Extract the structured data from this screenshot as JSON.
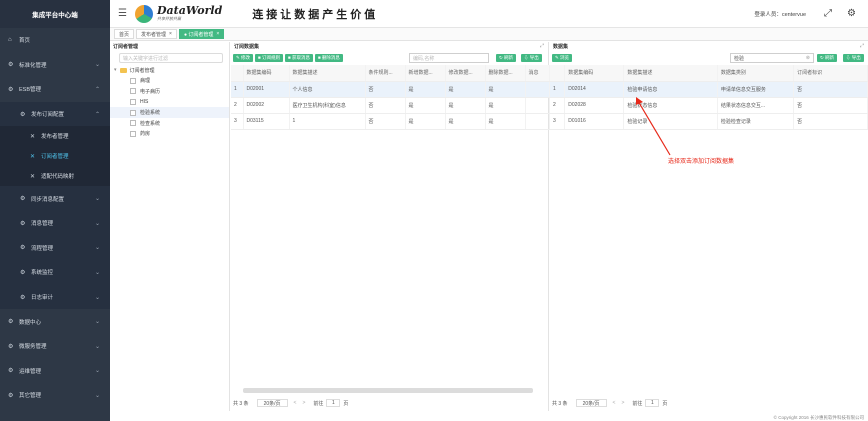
{
  "app_title": "集成平台中心端",
  "sidebar": {
    "items": [
      {
        "label": "首页",
        "icon": "home-icon",
        "glyph": "⌂"
      },
      {
        "label": "标准化管理",
        "icon": "gear-icon",
        "glyph": "⚙"
      },
      {
        "label": "ESB管理",
        "icon": "gear-icon",
        "glyph": "⚙"
      },
      {
        "label": "发布订阅配置",
        "icon": "gear-icon",
        "glyph": "⚙"
      },
      {
        "label": "发布者管理",
        "icon": "tools-icon",
        "glyph": "✕"
      },
      {
        "label": "订阅者管理",
        "icon": "tools-icon",
        "glyph": "✕"
      },
      {
        "label": "适配代码映射",
        "icon": "tools-icon",
        "glyph": "✕"
      },
      {
        "label": "同步消息配置",
        "icon": "gear-icon",
        "glyph": "⚙"
      },
      {
        "label": "消息管理",
        "icon": "gear-icon",
        "glyph": "⚙"
      },
      {
        "label": "流程管理",
        "icon": "gear-icon",
        "glyph": "⚙"
      },
      {
        "label": "系统监控",
        "icon": "gear-icon",
        "glyph": "⚙"
      },
      {
        "label": "日志审计",
        "icon": "gear-icon",
        "glyph": "⚙"
      },
      {
        "label": "数据中心",
        "icon": "gear-icon",
        "glyph": "⚙"
      },
      {
        "label": "微服务管理",
        "icon": "gear-icon",
        "glyph": "⚙"
      },
      {
        "label": "运维管理",
        "icon": "gear-icon",
        "glyph": "⚙"
      },
      {
        "label": "其它管理",
        "icon": "gear-icon",
        "glyph": "⚙"
      }
    ]
  },
  "header": {
    "logo_text": "DataWorld",
    "logo_sub": "共享开放共赢",
    "slogan": "连接让数据产生价值",
    "user_label": "登录人员：centervue"
  },
  "tabs": [
    {
      "label": "首页"
    },
    {
      "label": "发布者管理",
      "close": "×"
    },
    {
      "label": "● 订阅者管理",
      "close": "×"
    }
  ],
  "tree": {
    "title": "订阅者管理",
    "search_placeholder": "输入关键字进行过滤",
    "root": "订阅者管理",
    "children": [
      "病理",
      "电子病历",
      "HIS",
      "检验系统",
      "检查系统",
      "药房"
    ]
  },
  "mid": {
    "title": "订阅数据集",
    "buttons": [
      "✎ 修改",
      "■ 订阅规则",
      "■ 获取消息",
      "■ 删除消息"
    ],
    "search_placeholder": "编码,名称",
    "refresh": "↻ 刷新",
    "export": "⇩ 导出",
    "columns": [
      "",
      "数据集编码",
      "数据集描述",
      "条件规则...",
      "新增数据...",
      "修改数据...",
      "删除数据...",
      "消息"
    ],
    "rows": [
      [
        "1",
        "D02001",
        "个人信息",
        "否",
        "是",
        "是",
        "是",
        ""
      ],
      [
        "2",
        "D02002",
        "医疗卫生机构(科室)信息",
        "否",
        "是",
        "是",
        "是",
        ""
      ],
      [
        "3",
        "D03115",
        "1",
        "否",
        "是",
        "是",
        "是",
        ""
      ]
    ],
    "pager": {
      "total": "共 3 条",
      "size": "20条/页",
      "prev": "<",
      "next": ">",
      "goto": "前往",
      "page": "1",
      "unit": "页"
    }
  },
  "right": {
    "title": "数据集",
    "button": "✎ 浏览",
    "search_value": "检验",
    "refresh": "↻ 刷新",
    "export": "⇩ 导出",
    "columns": [
      "",
      "数据集编码",
      "数据集描述",
      "数据集类别",
      "订阅者标识"
    ],
    "rows": [
      [
        "1",
        "D02014",
        "检验申请信息",
        "申请单信息交互服务",
        "否"
      ],
      [
        "2",
        "D02028",
        "检验状态信息",
        "结果状态信息交互...",
        "否"
      ],
      [
        "3",
        "D01016",
        "检验记录",
        "检验检查记录",
        "否"
      ]
    ],
    "pager": {
      "total": "共 3 条",
      "size": "20条/页",
      "prev": "<",
      "next": ">",
      "goto": "前往",
      "page": "1",
      "unit": "页"
    }
  },
  "annotation": "选择双击添加订阅数据集",
  "footer": "© Copyright 2016 长沙惠民软件科技有限公司"
}
